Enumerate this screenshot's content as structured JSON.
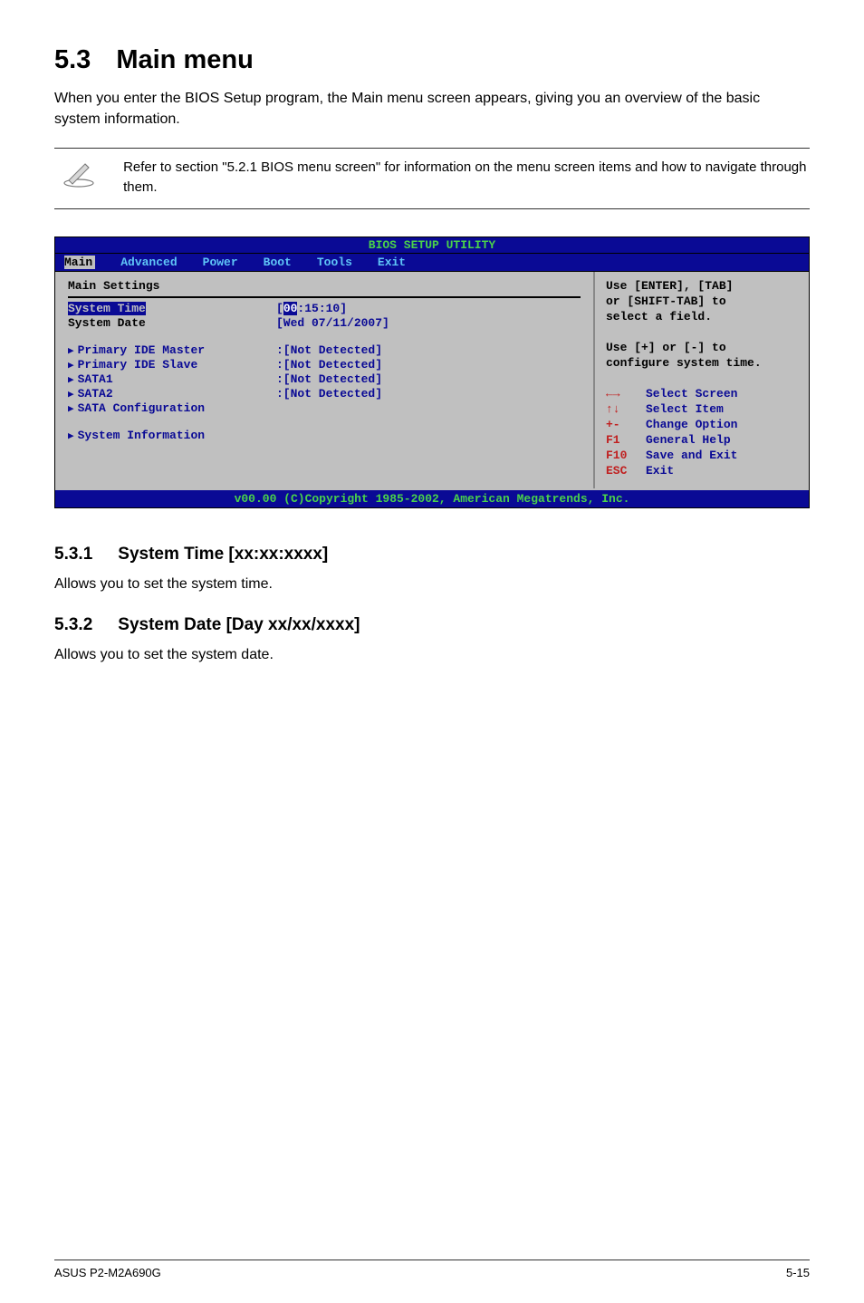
{
  "heading": {
    "num": "5.3",
    "title": "Main menu"
  },
  "intro": "When you enter the BIOS Setup program, the Main menu screen appears, giving you an overview of the basic system information.",
  "note": "Refer to section \"5.2.1  BIOS menu screen\" for information on the menu screen items and how to navigate through them.",
  "bios": {
    "title": "BIOS SETUP UTILITY",
    "menu": [
      "Main",
      "Advanced",
      "Power",
      "Boot",
      "Tools",
      "Exit"
    ],
    "panel_title": "Main Settings",
    "rows": [
      {
        "label": "System Time",
        "value_prefix": "[",
        "value_sel": "00",
        "value_rest": ":15:10]",
        "selected": true
      },
      {
        "label": "System Date",
        "value": "[Wed 07/11/2007]"
      }
    ],
    "items": [
      {
        "label": "Primary IDE Master",
        "value": ":[Not Detected]"
      },
      {
        "label": "Primary IDE Slave",
        "value": ":[Not Detected]"
      },
      {
        "label": "SATA1",
        "value": ":[Not Detected]"
      },
      {
        "label": "SATA2",
        "value": ":[Not Detected]"
      },
      {
        "label": "SATA Configuration",
        "value": ""
      },
      {
        "label": "",
        "value": ""
      },
      {
        "label": "System Information",
        "value": ""
      }
    ],
    "help_top": [
      "Use [ENTER], [TAB]",
      "or [SHIFT-TAB] to",
      "select a field.",
      "",
      "Use [+] or [-] to",
      "configure system time."
    ],
    "help_keys": [
      {
        "k": "←→",
        "v": "Select Screen"
      },
      {
        "k": "↑↓",
        "v": "Select Item"
      },
      {
        "k": "+-",
        "v": "Change Option"
      },
      {
        "k": "F1",
        "v": "General Help"
      },
      {
        "k": "F10",
        "v": "Save and Exit"
      },
      {
        "k": "ESC",
        "v": "Exit"
      }
    ],
    "footer": "v00.00 (C)Copyright 1985-2002, American Megatrends, Inc."
  },
  "sec1": {
    "num": "5.3.1",
    "title": "System Time [xx:xx:xxxx]",
    "body": "Allows you to set the system time."
  },
  "sec2": {
    "num": "5.3.2",
    "title": "System Date [Day xx/xx/xxxx]",
    "body": "Allows you to set the system date."
  },
  "footer": {
    "left": "ASUS P2-M2A690G",
    "right": "5-15"
  }
}
